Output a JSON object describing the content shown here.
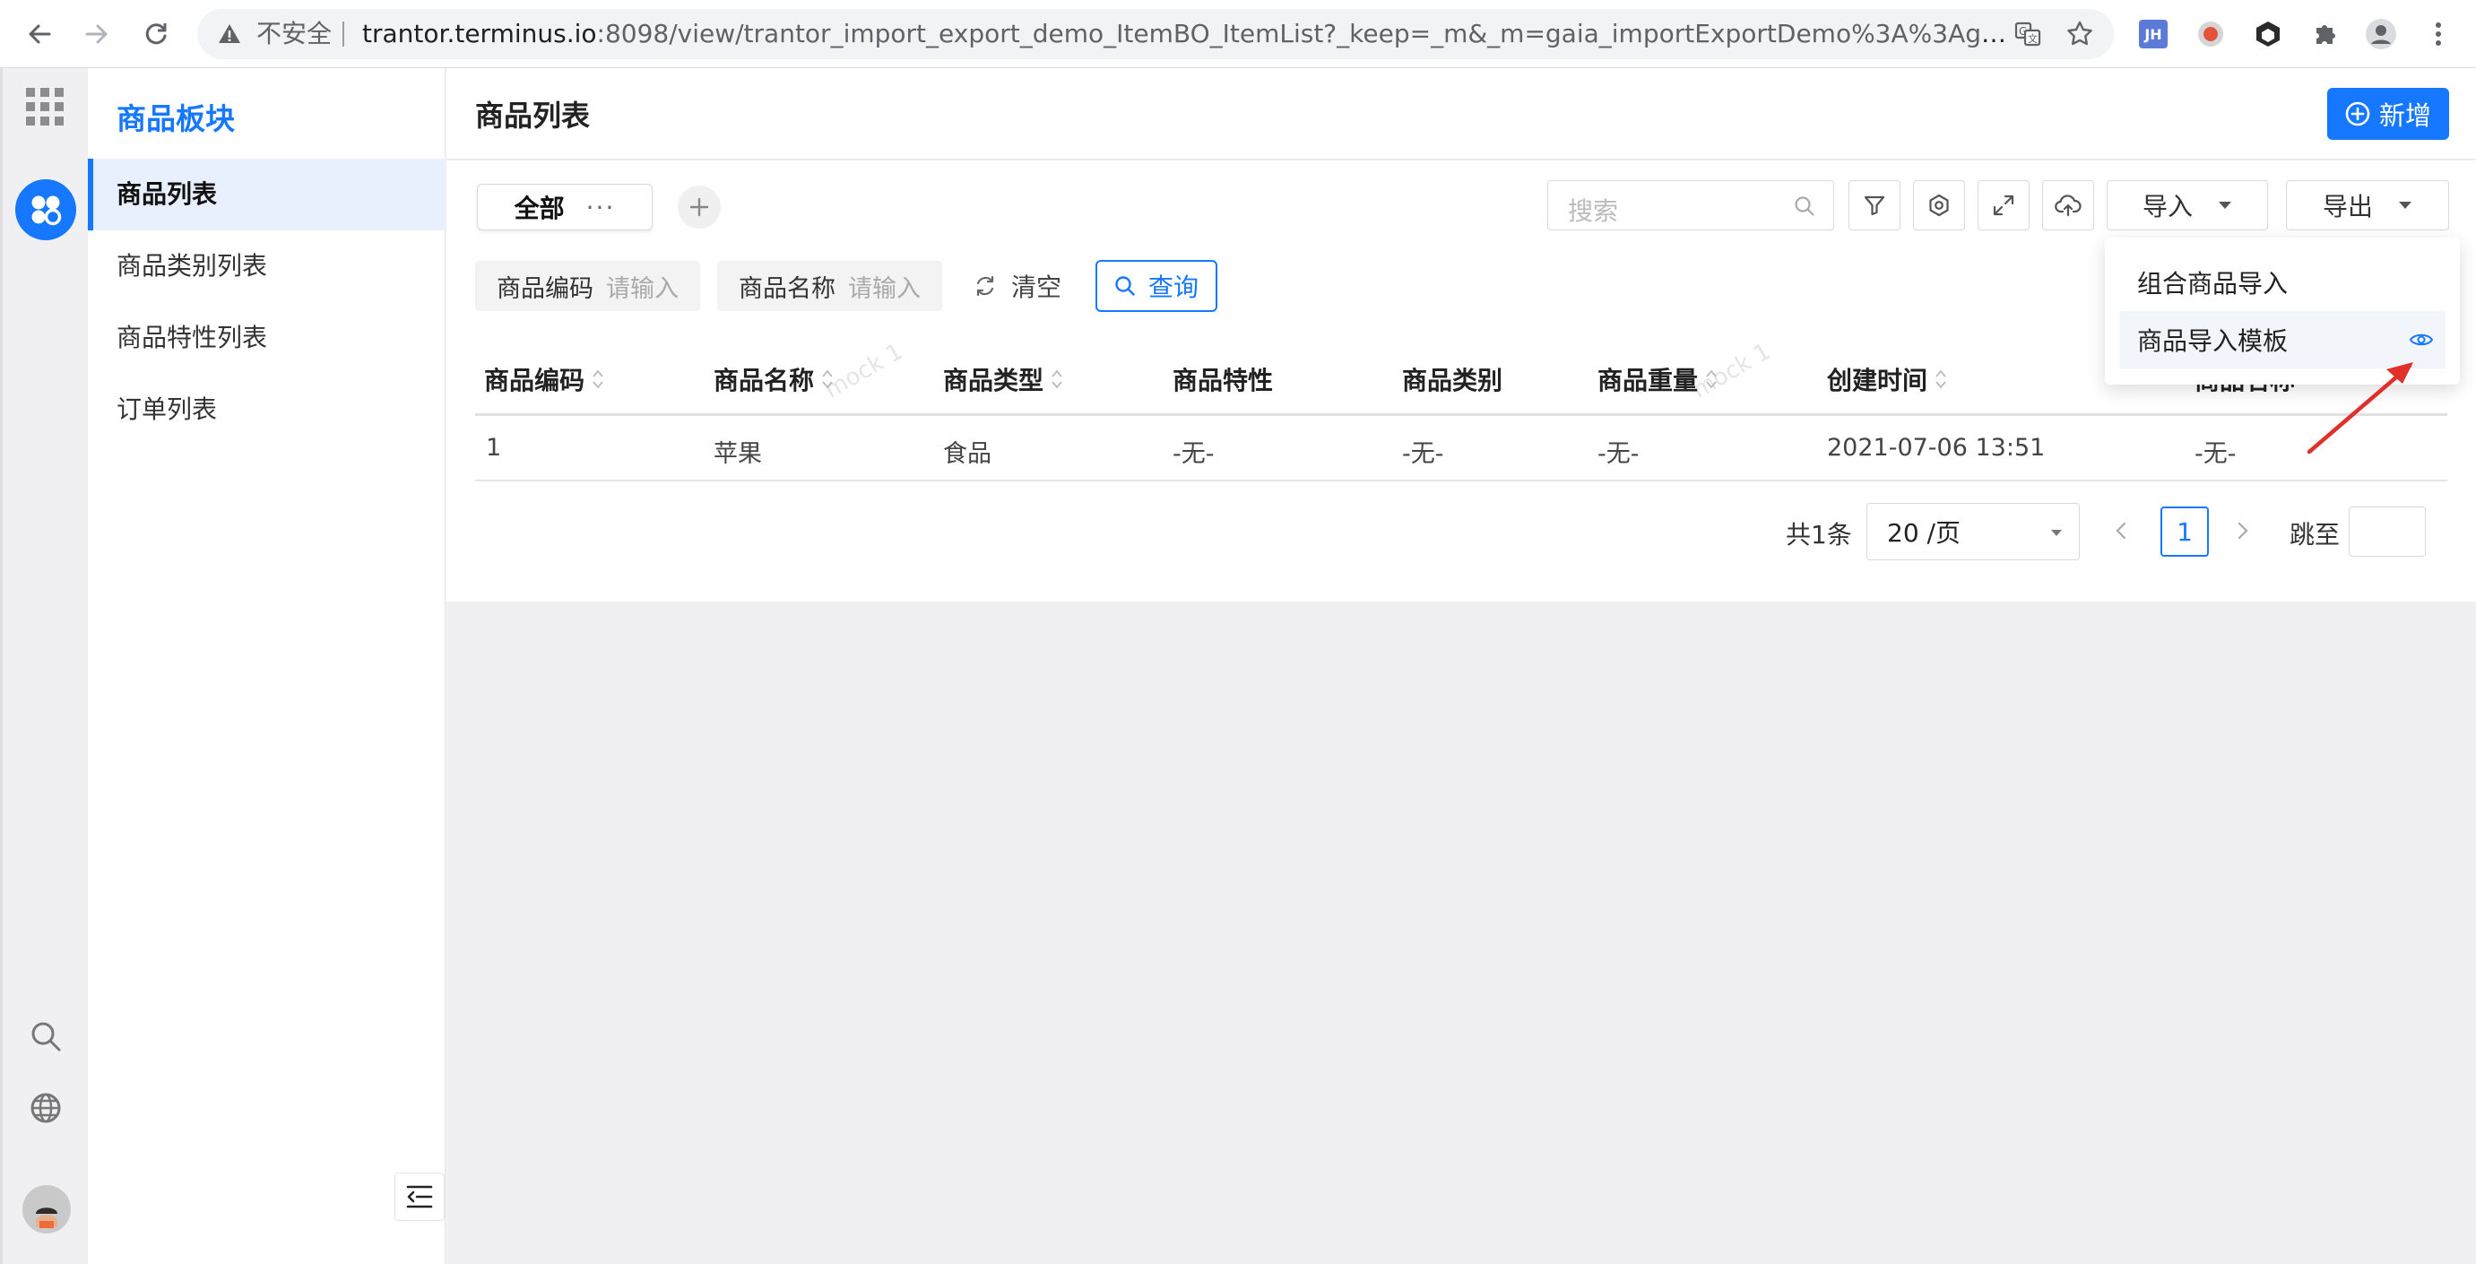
{
  "browser": {
    "insecure_label": "不安全",
    "url_host": "trantor.terminus.io",
    "url_path": ":8098/view/trantor_import_export_demo_ItemBO_ItemList?_keep=_m&_m=gaia_importExportDemo%3A%3Agaia_imp...",
    "ext_badge": "JH"
  },
  "sidebar": {
    "brand": "商品板块",
    "items": [
      {
        "label": "商品列表"
      },
      {
        "label": "商品类别列表"
      },
      {
        "label": "商品特性列表"
      },
      {
        "label": "订单列表"
      }
    ]
  },
  "header": {
    "title": "商品列表",
    "add_label": "新增"
  },
  "toolbar": {
    "tab_all": "全部",
    "tab_more": "···",
    "search_placeholder": "搜索",
    "import_label": "导入",
    "export_label": "导出"
  },
  "filters": {
    "code_label": "商品编码",
    "code_placeholder": "请输入",
    "name_label": "商品名称",
    "name_placeholder": "请输入",
    "clear_label": "清空",
    "query_label": "查询"
  },
  "table": {
    "columns": [
      "商品编码",
      "商品名称",
      "商品类型",
      "商品特性",
      "商品类别",
      "商品重量",
      "创建时间",
      "商品名称"
    ],
    "rows": [
      [
        "1",
        "苹果",
        "食品",
        "-无-",
        "-无-",
        "-无-",
        "2021-07-06 13:51",
        "-无-"
      ]
    ]
  },
  "watermarks": [
    "mock 1",
    "mock 1"
  ],
  "pagination": {
    "total": "共1条",
    "page_size": "20 /页",
    "current": "1",
    "jump_label": "跳至"
  },
  "import_menu": {
    "items": [
      {
        "label": "组合商品导入"
      },
      {
        "label": "商品导入模板"
      }
    ]
  },
  "colors": {
    "accent": "#1677ff",
    "arrow": "#e0302a"
  }
}
